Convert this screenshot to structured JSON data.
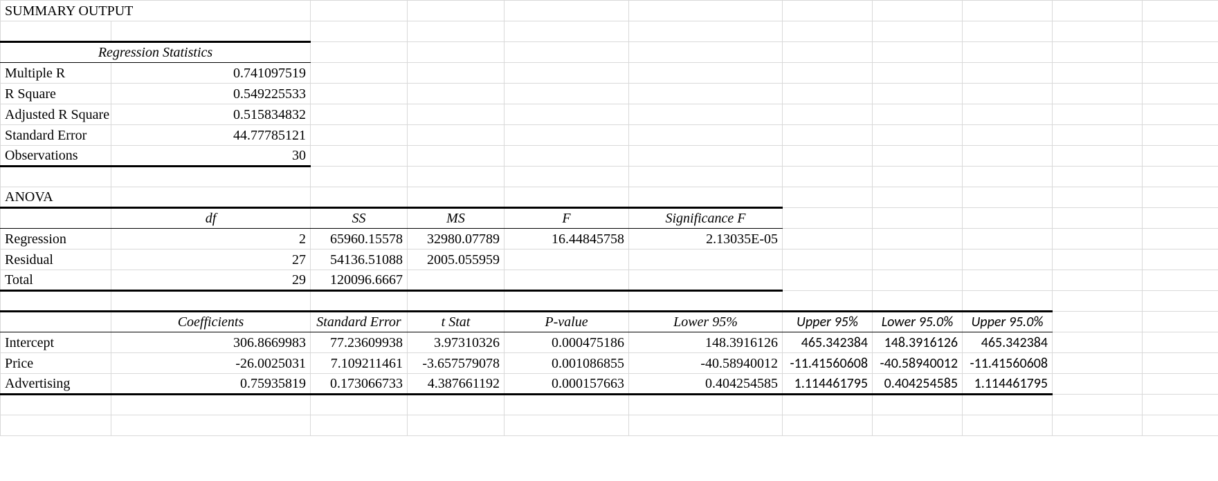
{
  "title": "SUMMARY OUTPUT",
  "regression_stats": {
    "header": "Regression Statistics",
    "rows": [
      {
        "label": "Multiple R",
        "value": "0.741097519"
      },
      {
        "label": "R Square",
        "value": "0.549225533"
      },
      {
        "label": "Adjusted R Square",
        "value": "0.515834832"
      },
      {
        "label": "Standard Error",
        "value": "44.77785121"
      },
      {
        "label": "Observations",
        "value": "30"
      }
    ]
  },
  "anova": {
    "title": "ANOVA",
    "headers": {
      "df": "df",
      "ss": "SS",
      "ms": "MS",
      "f": "F",
      "sigf": "Significance F"
    },
    "rows": [
      {
        "label": "Regression",
        "df": "2",
        "ss": "65960.15578",
        "ms": "32980.07789",
        "f": "16.44845758",
        "sigf": "2.13035E-05"
      },
      {
        "label": "Residual",
        "df": "27",
        "ss": "54136.51088",
        "ms": "2005.055959",
        "f": "",
        "sigf": ""
      },
      {
        "label": "Total",
        "df": "29",
        "ss": "120096.6667",
        "ms": "",
        "f": "",
        "sigf": ""
      }
    ]
  },
  "coeff": {
    "headers": {
      "coefficients": "Coefficients",
      "stderr": "Standard Error",
      "tstat": "t Stat",
      "pvalue": "P-value",
      "lower95": "Lower 95%",
      "upper95": "Upper 95%",
      "lower95_0": "Lower 95.0%",
      "upper95_0": "Upper 95.0%"
    },
    "rows": [
      {
        "label": "Intercept",
        "coef": "306.8669983",
        "se": "77.23609938",
        "t": "3.97310326",
        "p": "0.000475186",
        "lo": "148.3916126",
        "up": "465.342384",
        "lo0": "148.3916126",
        "up0": "465.342384"
      },
      {
        "label": "Price",
        "coef": "-26.0025031",
        "se": "7.109211461",
        "t": "-3.657579078",
        "p": "0.001086855",
        "lo": "-40.58940012",
        "up": "-11.41560608",
        "lo0": "-40.58940012",
        "up0": "-11.41560608"
      },
      {
        "label": "Advertising",
        "coef": "0.75935819",
        "se": "0.173066733",
        "t": "4.387661192",
        "p": "0.000157663",
        "lo": "0.404254585",
        "up": "1.114461795",
        "lo0": "0.404254585",
        "up0": "1.114461795"
      }
    ]
  }
}
